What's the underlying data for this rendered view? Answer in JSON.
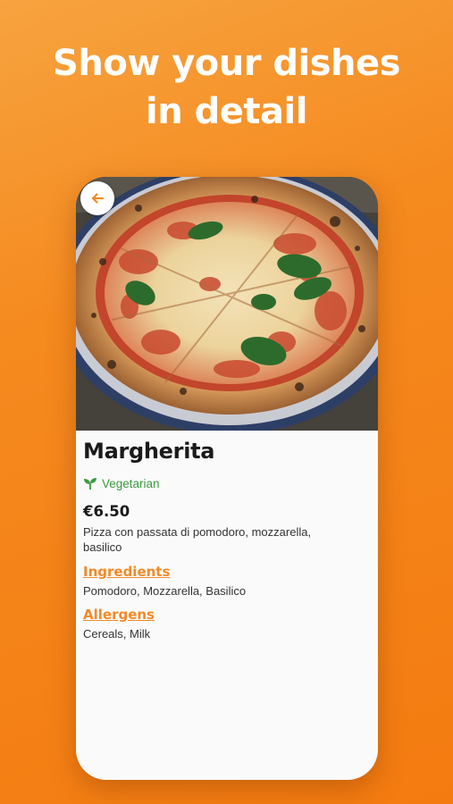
{
  "headline": {
    "line1": "Show your dishes",
    "line2": "in detail"
  },
  "icons": {
    "back": "arrow-left-icon",
    "vegetarian": "sprout-leaf-icon"
  },
  "colors": {
    "background": "#f58a1f",
    "accent": "#f28a27",
    "vegetarian": "#3a9a3e"
  },
  "dish": {
    "name": "Margherita",
    "badge": "Vegetarian",
    "price": "€6.50",
    "description": "Pizza con passata di pomodoro, mozzarella, basilico",
    "ingredients": {
      "title": "Ingredients",
      "text": "Pomodoro, Mozzarella, Basilico"
    },
    "allergens": {
      "title": "Allergens",
      "text": "Cereals, Milk"
    }
  }
}
